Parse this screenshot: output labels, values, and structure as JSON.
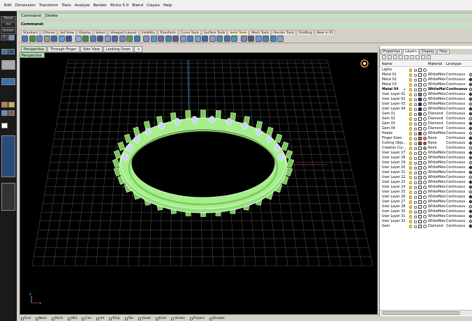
{
  "menu": [
    "Edit",
    "Dimension",
    "Transform",
    "Tools",
    "Analyze",
    "Render",
    "Rhino 5.0",
    "Blend",
    "Clayoo",
    "Help"
  ],
  "command": {
    "line1": "Command: _Delete",
    "line2": "Command:"
  },
  "left_strip": {
    "reset": "Reset",
    "art": "Art",
    "render": "Render",
    "o": "O"
  },
  "toolbar_tabs": [
    "Standard",
    "CPlanes",
    "Set View",
    "Display",
    "Select",
    "Viewport Layout",
    "Visibility",
    "Transform",
    "Curve Tools",
    "Surface Tools",
    "Solid Tools",
    "Mesh Tools",
    "Render Tools",
    "Drafting",
    "New in V5"
  ],
  "active_toolbar_tab": "Solid Tools",
  "viewport_tabs": [
    "Perspective",
    "Through Finger",
    "Side View",
    "Looking Down"
  ],
  "viewport_add": "+",
  "viewport_label": "Perspective",
  "viewport_label_arrow": "▾",
  "axis": {
    "z": "z",
    "x": "x"
  },
  "panel_tabs": [
    "Properties",
    "Layers",
    "Display",
    "Help"
  ],
  "layer_columns": {
    "name": "Name",
    "material": "Material",
    "linetype": "Linetype"
  },
  "layers": [
    {
      "name": "Lights",
      "material": "",
      "linetype": "",
      "color": "#ffffff",
      "mat": "#ffffff"
    },
    {
      "name": "Metal 01",
      "material": "WhiteMetal",
      "linetype": "Continuous",
      "color": "#ffffff",
      "mat": "#ffffff"
    },
    {
      "name": "Metal 02",
      "material": "WhiteMetal",
      "linetype": "Continuous",
      "color": "#ffffff",
      "mat": "#ffffff"
    },
    {
      "name": "Metal 03",
      "material": "WhiteMetal",
      "linetype": "Continuous",
      "color": "#ffffff",
      "mat": "#ffffff"
    },
    {
      "name": "Metal 04",
      "material": "WhiteMet...",
      "linetype": "Continuous",
      "color": "#ffffff",
      "mat": "#ffffff",
      "current": true,
      "check": "✓"
    },
    {
      "name": "User Layer 01",
      "material": "WhiteMetal",
      "linetype": "Continuous",
      "color": "#3aaf3a",
      "mat": "#ffffff"
    },
    {
      "name": "User Layer 02",
      "material": "WhiteMetal",
      "linetype": "Continuous",
      "color": "#1a3fa0",
      "mat": "#ffffff"
    },
    {
      "name": "User Layer 03",
      "material": "WhiteMetal",
      "linetype": "Continuous",
      "color": "#1a2f8a",
      "mat": "#ffffff"
    },
    {
      "name": "User Layer 04",
      "material": "WhiteMetal",
      "linetype": "Continuous",
      "color": "#1a1a70",
      "mat": "#ffffff"
    },
    {
      "name": "Gem 01",
      "material": "Diamond",
      "linetype": "Continuous",
      "color": "#20a020",
      "mat": "#ffffff"
    },
    {
      "name": "Gem 02",
      "material": "Diamond",
      "linetype": "Continuous",
      "color": "#ffffff",
      "mat": "#ffffff"
    },
    {
      "name": "Gem 03",
      "material": "Diamond",
      "linetype": "Continuous",
      "color": "#ffffff",
      "mat": "#ffffff"
    },
    {
      "name": "Gem 04",
      "material": "Diamond",
      "linetype": "Continuous",
      "color": "#ffffff",
      "mat": "#ffffff"
    },
    {
      "name": "Heads",
      "material": "WhiteMetal",
      "linetype": "Continuous",
      "color": "#d03030",
      "mat": "#ffffff"
    },
    {
      "name": "Finger Sizes",
      "material": "None",
      "linetype": "Continuous",
      "color": "#d07a20",
      "mat": "#e89a40"
    },
    {
      "name": "Cutting Obje...",
      "material": "None",
      "linetype": "Continuous",
      "color": "#c03030",
      "mat": "#c04040"
    },
    {
      "name": "Creation Cur...",
      "material": "None",
      "linetype": "Continuous",
      "color": "#ffffff",
      "mat": "#e0a020"
    },
    {
      "name": "User Layer 17",
      "material": "WhiteMetal",
      "linetype": "Continuous",
      "color": "#ffffff",
      "mat": "#ffffff"
    },
    {
      "name": "User Layer 18",
      "material": "WhiteMetal",
      "linetype": "Continuous",
      "color": "#ffffff",
      "mat": "#ffffff"
    },
    {
      "name": "User Layer 19",
      "material": "WhiteMetal",
      "linetype": "Continuous",
      "color": "#ffffff",
      "mat": "#ffffff"
    },
    {
      "name": "User Layer 20",
      "material": "WhiteMetal",
      "linetype": "Continuous",
      "color": "#ffffff",
      "mat": "#ffffff"
    },
    {
      "name": "User Layer 21",
      "material": "WhiteMetal",
      "linetype": "Continuous",
      "color": "#ffffff",
      "mat": "#ffffff"
    },
    {
      "name": "User Layer 22",
      "material": "WhiteMetal",
      "linetype": "Continuous",
      "color": "#ffffff",
      "mat": "#ffffff"
    },
    {
      "name": "User Layer 23",
      "material": "WhiteMetal",
      "linetype": "Continuous",
      "color": "#ffffff",
      "mat": "#ffffff"
    },
    {
      "name": "User Layer 24",
      "material": "WhiteMetal",
      "linetype": "Continuous",
      "color": "#ffffff",
      "mat": "#ffffff"
    },
    {
      "name": "User Layer 25",
      "material": "WhiteMetal",
      "linetype": "Continuous",
      "color": "#ffffff",
      "mat": "#ffffff"
    },
    {
      "name": "User Layer 26",
      "material": "WhiteMetal",
      "linetype": "Continuous",
      "color": "#ffffff",
      "mat": "#ffffff"
    },
    {
      "name": "User Layer 27",
      "material": "WhiteMetal",
      "linetype": "Continuous",
      "color": "#ffffff",
      "mat": "#ffffff"
    },
    {
      "name": "User Layer 28",
      "material": "WhiteMetal",
      "linetype": "Continuous",
      "color": "#ffffff",
      "mat": "#ffffff"
    },
    {
      "name": "User Layer 30",
      "material": "WhiteMetal",
      "linetype": "Continuous",
      "color": "#ffffff",
      "mat": "#ffffff"
    },
    {
      "name": "User Layer 31",
      "material": "WhiteMetal",
      "linetype": "Continuous",
      "color": "#ffffff",
      "mat": "#ffffff"
    },
    {
      "name": "User Layer 32",
      "material": "WhiteMetal",
      "linetype": "Continuous",
      "color": "#ffffff",
      "mat": "#ffffff"
    },
    {
      "name": "Gem",
      "material": "Diamond",
      "linetype": "Continuous",
      "color": "#ffffff",
      "mat": "#ffffff"
    }
  ],
  "osnaps": [
    "End",
    "Near",
    "Point",
    "Mid",
    "Cen",
    "Int",
    "Perp",
    "Tan",
    "Quad",
    "Knot",
    "Vertex",
    "Project",
    "Disable"
  ],
  "colors": {
    "ring": "#9be87a",
    "grid": "#4a4a4a",
    "x_axis": "#b03030",
    "y_axis": "#5aa0d8",
    "command_bg": "#c5e0c5"
  }
}
